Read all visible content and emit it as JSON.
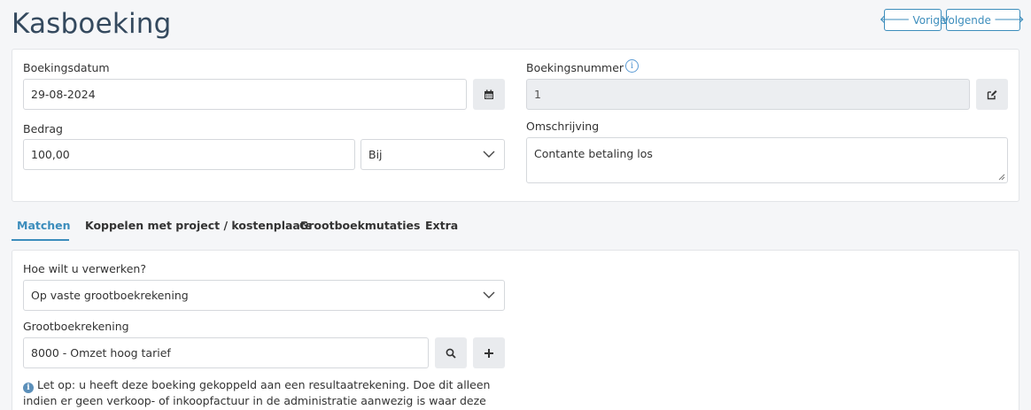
{
  "page": {
    "title": "Kasboeking"
  },
  "nav": {
    "prev_label": "Vorige",
    "next_label": "Volgende"
  },
  "form": {
    "boekingsdatum_label": "Boekingsdatum",
    "boekingsdatum_value": "29-08-2024",
    "boekingsnummer_label": "Boekingsnummer",
    "boekingsnummer_value": "1",
    "bedrag_label": "Bedrag",
    "bedrag_value": "100,00",
    "bij_af_value": "Bij",
    "omschrijving_label": "Omschrijving",
    "omschrijving_value": "Contante betaling los"
  },
  "tabs": [
    {
      "label": "Matchen",
      "active": true
    },
    {
      "label": "Koppelen met project / kostenplaats",
      "active": false
    },
    {
      "label": "Grootboekmutaties",
      "active": false
    },
    {
      "label": "Extra",
      "active": false
    }
  ],
  "matchen": {
    "verwerken_label": "Hoe wilt u verwerken?",
    "verwerken_value": "Op vaste grootboekrekening",
    "grootboek_label": "Grootboekrekening",
    "grootboek_value": "8000 - Omzet hoog tarief",
    "note": "Let op: u heeft deze boeking gekoppeld aan een resultaatrekening. Doe dit alleen indien er geen verkoop- of inkoopfactuur in de administratie aanwezig is waar deze betaling/ontvangst bij"
  },
  "colors": {
    "accent": "#3c8dbc",
    "title": "#34495e"
  }
}
